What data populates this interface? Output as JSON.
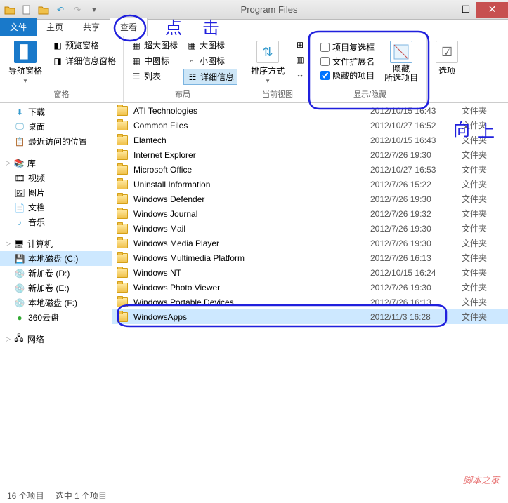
{
  "window": {
    "title": "Program Files"
  },
  "tabs": {
    "file": "文件",
    "home": "主页",
    "share": "共享",
    "view": "查看"
  },
  "ribbon": {
    "pane_group": "窗格",
    "nav_pane": "导航窗格",
    "preview_pane": "预览窗格",
    "detail_pane": "详细信息窗格",
    "layout_group": "布局",
    "xlarge": "超大图标",
    "large": "大图标",
    "medium": "中图标",
    "small": "小图标",
    "list": "列表",
    "details": "详细信息",
    "view_group": "当前视图",
    "sort": "排序方式",
    "showhide_group": "显示/隐藏",
    "chk_checkbox": "项目复选框",
    "chk_ext": "文件扩展名",
    "chk_hidden": "隐藏的项目",
    "hide_sel": "隐藏\n所选项目",
    "options": "选项"
  },
  "sidebar": {
    "downloads": "下载",
    "desktop": "桌面",
    "recent": "最近访问的位置",
    "libraries": "库",
    "videos": "视频",
    "pictures": "图片",
    "documents": "文档",
    "music": "音乐",
    "computer": "计算机",
    "disk_c": "本地磁盘 (C:)",
    "disk_d": "新加卷 (D:)",
    "disk_e": "新加卷 (E:)",
    "disk_f": "本地磁盘 (F:)",
    "cloud": "360云盘",
    "network": "网络"
  },
  "files": [
    {
      "name": "ATI Technologies",
      "date": "2012/10/15 16:43",
      "type": "文件夹"
    },
    {
      "name": "Common Files",
      "date": "2012/10/27 16:52",
      "type": "文件夹"
    },
    {
      "name": "Elantech",
      "date": "2012/10/15 16:43",
      "type": "文件夹"
    },
    {
      "name": "Internet Explorer",
      "date": "2012/7/26 19:30",
      "type": "文件夹"
    },
    {
      "name": "Microsoft Office",
      "date": "2012/10/27 16:53",
      "type": "文件夹"
    },
    {
      "name": "Uninstall Information",
      "date": "2012/7/26 15:22",
      "type": "文件夹"
    },
    {
      "name": "Windows Defender",
      "date": "2012/7/26 19:30",
      "type": "文件夹"
    },
    {
      "name": "Windows Journal",
      "date": "2012/7/26 19:32",
      "type": "文件夹"
    },
    {
      "name": "Windows Mail",
      "date": "2012/7/26 19:30",
      "type": "文件夹"
    },
    {
      "name": "Windows Media Player",
      "date": "2012/7/26 19:30",
      "type": "文件夹"
    },
    {
      "name": "Windows Multimedia Platform",
      "date": "2012/7/26 16:13",
      "type": "文件夹"
    },
    {
      "name": "Windows NT",
      "date": "2012/10/15 16:24",
      "type": "文件夹"
    },
    {
      "name": "Windows Photo Viewer",
      "date": "2012/7/26 19:30",
      "type": "文件夹"
    },
    {
      "name": "Windows Portable Devices",
      "date": "2012/7/26 16:13",
      "type": "文件夹"
    },
    {
      "name": "WindowsApps",
      "date": "2012/11/3 16:28",
      "type": "文件夹",
      "selected": true
    }
  ],
  "status": {
    "count": "16 个项目",
    "selected": "选中 1 个项目"
  },
  "annotations": {
    "click": "点击",
    "up": "向上"
  },
  "watermark": "脚本之家"
}
